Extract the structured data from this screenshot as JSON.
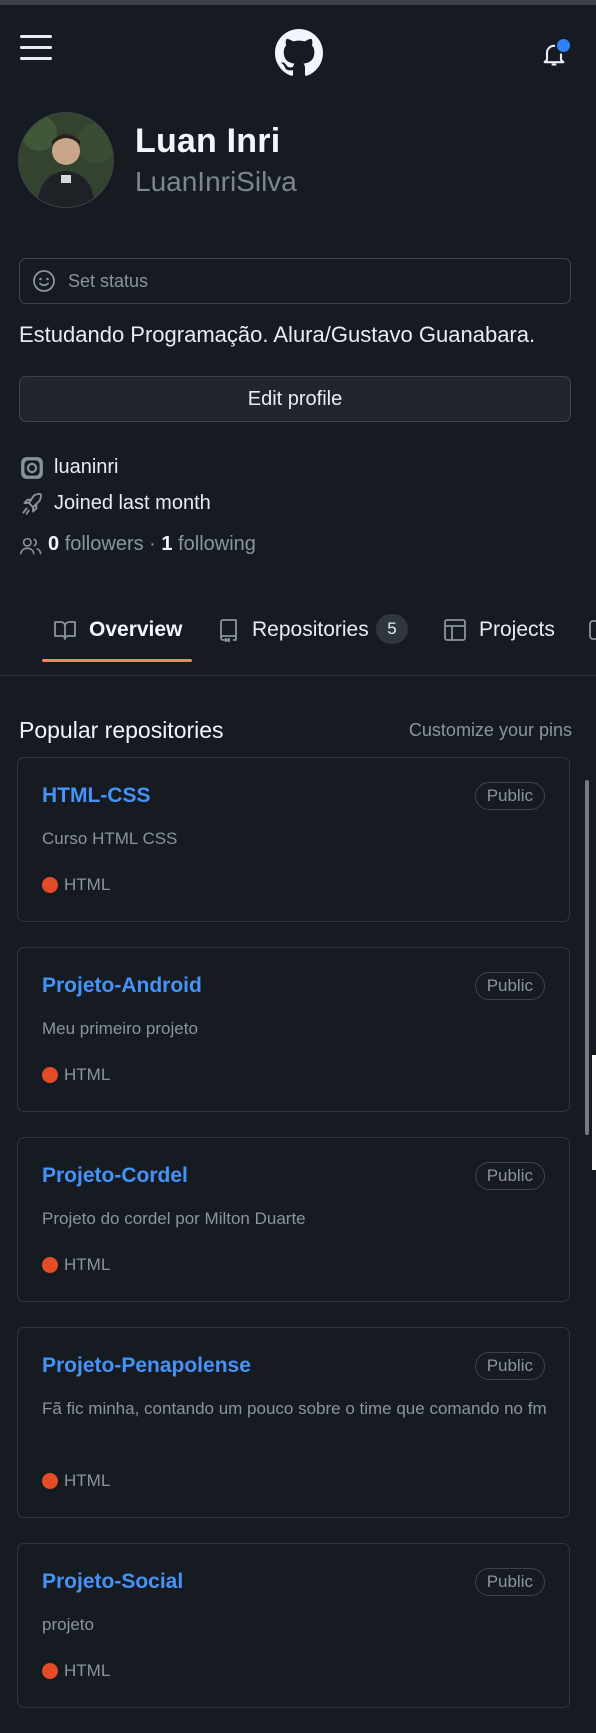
{
  "header": {
    "menu_icon": "hamburger-menu-icon",
    "logo_icon": "github-logo-icon",
    "notifications_icon": "bell-icon",
    "accent_color": "#2f81f7"
  },
  "profile": {
    "name": "Luan Inri",
    "login": "LuanInriSilva",
    "status_placeholder": "Set status",
    "bio": "Estudando Programação. Alura/Gustavo Guanabara.",
    "edit_button": "Edit profile",
    "instagram": "luaninri",
    "joined": "Joined last month",
    "followers_count": "0",
    "followers_label": "followers",
    "separator": "·",
    "following_count": "1",
    "following_label": "following"
  },
  "tabs": [
    {
      "label": "Overview",
      "icon": "book-icon",
      "selected": true
    },
    {
      "label": "Repositories",
      "icon": "repo-icon",
      "count": "5"
    },
    {
      "label": "Projects",
      "icon": "table-icon"
    }
  ],
  "popular": {
    "title": "Popular repositories",
    "customize_label": "Customize your pins",
    "language_color": "#e34c26",
    "repos": [
      {
        "name": "HTML-CSS",
        "visibility": "Public",
        "description": "Curso HTML CSS",
        "language": "HTML"
      },
      {
        "name": "Projeto-Android",
        "visibility": "Public",
        "description": "Meu primeiro projeto",
        "language": "HTML"
      },
      {
        "name": "Projeto-Cordel",
        "visibility": "Public",
        "description": "Projeto do cordel por Milton Duarte",
        "language": "HTML"
      },
      {
        "name": "Projeto-Penapolense",
        "visibility": "Public",
        "description": "Fã fic minha, contando um pouco sobre o time que comando no fm",
        "language": "HTML"
      },
      {
        "name": "Projeto-Social",
        "visibility": "Public",
        "description": "projeto",
        "language": "HTML"
      }
    ]
  }
}
